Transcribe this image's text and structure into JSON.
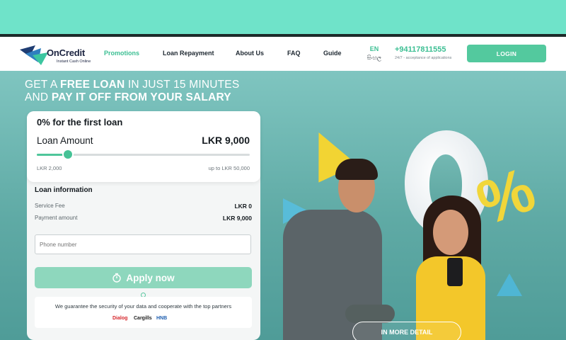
{
  "header": {
    "logo": {
      "title": "OnCredit",
      "subtitle": "Instant Cash Online"
    },
    "nav": [
      {
        "label": "Promotions",
        "active": true
      },
      {
        "label": "Loan Repayment",
        "active": false
      },
      {
        "label": "About Us",
        "active": false
      },
      {
        "label": "FAQ",
        "active": false
      },
      {
        "label": "Guide",
        "active": false
      }
    ],
    "lang": {
      "current": "EN",
      "alt": "සිංහල"
    },
    "contact": {
      "phone": "+94117811555",
      "note": "24/7 - acceptance of applications"
    },
    "login_label": "LOGIN"
  },
  "hero": {
    "line1_a": "GET A ",
    "line1_b": "FREE LOAN",
    "line1_c": " IN JUST 15 MINUTES",
    "line2_a": "AND ",
    "line2_b": "PAY IT OFF FROM YOUR SALARY",
    "more_label": "IN MORE DETAIL",
    "promo_percent": "%"
  },
  "form": {
    "first_loan": "0% for the first loan",
    "amount_label": "Loan Amount",
    "amount_value": "LKR 9,000",
    "slider": {
      "min_label": "LKR 2,000",
      "max_label": "up to LKR 50,000",
      "min": 2000,
      "max": 50000,
      "value": 9000
    },
    "info_title": "Loan information",
    "service_fee_label": "Service Fee",
    "service_fee_value": "LKR 0",
    "payment_label": "Payment amount",
    "payment_value": "LKR 9,000",
    "phone_placeholder": "Phone number",
    "apply_label": "Apply now",
    "guarantee": "We guarantee the security of your data and cooperate with the top partners",
    "partners": [
      "Dialog",
      "Cargills",
      "HNB"
    ]
  },
  "colors": {
    "accent": "#53c99e",
    "hero_bg": "#6fb8b3",
    "top_band": "#6fe3c9"
  }
}
